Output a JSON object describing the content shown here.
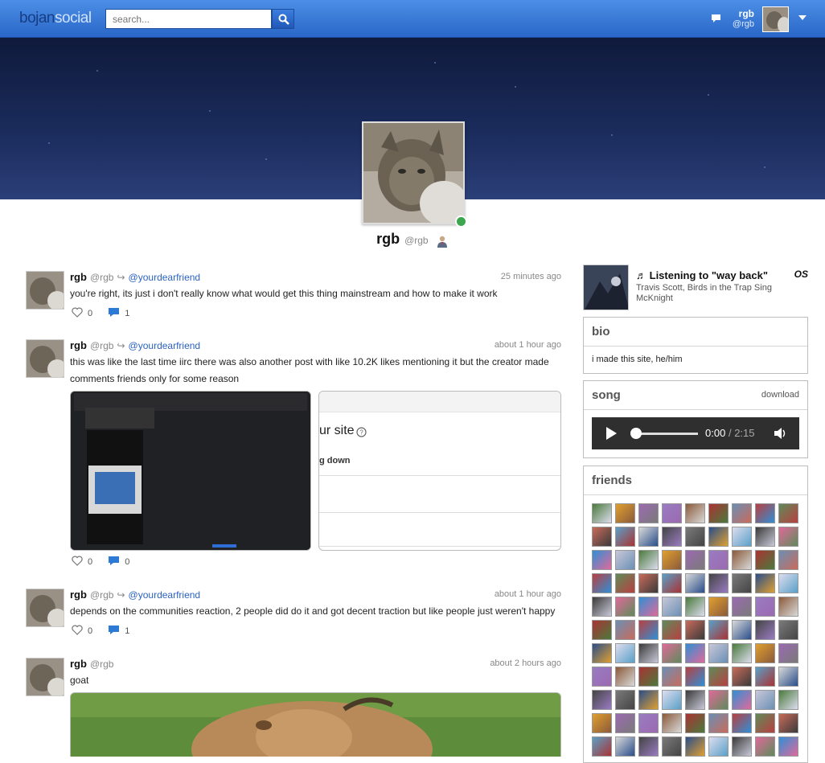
{
  "topbar": {
    "logo_a": "bojan",
    "logo_b": "social",
    "search_placeholder": "search...",
    "user_name": "rgb",
    "user_handle": "@rgb"
  },
  "profile": {
    "name": "rgb",
    "handle": "@rgb"
  },
  "posts": [
    {
      "name": "rgb",
      "handle": "@rgb",
      "arrow": "↪",
      "to": "@yourdearfriend",
      "time": "25 minutes ago",
      "text": "you're right, its just i don't really know what would get this thing mainstream and how to make it work",
      "likes": "0",
      "comments": "1"
    },
    {
      "name": "rgb",
      "handle": "@rgb",
      "arrow": "↪",
      "to": "@yourdearfriend",
      "time": "about 1 hour ago",
      "text": "this was like the last time iirc there was also another post with like 10.2K likes mentioning it but the creator made comments friends only for some reason",
      "likes": "0",
      "comments": "0",
      "embed_text_1": "ur site",
      "embed_text_2": "g down"
    },
    {
      "name": "rgb",
      "handle": "@rgb",
      "arrow": "↪",
      "to": "@yourdearfriend",
      "time": "about 1 hour ago",
      "text": "depends on the communities reaction, 2 people did do it and got decent traction but like people just weren't happy",
      "likes": "0",
      "comments": "1"
    },
    {
      "name": "rgb",
      "handle": "@rgb",
      "time": "about 2 hours ago",
      "text": "goat"
    }
  ],
  "now_playing": {
    "title": "Listening to \"way back\"",
    "subtitle": "Travis Scott, Birds in the Trap Sing McKnight",
    "service": "OS"
  },
  "bio": {
    "heading": "bio",
    "text": "i made this site, he/him"
  },
  "song": {
    "heading": "song",
    "download": "download",
    "current": "0:00",
    "separator": "/",
    "total": "2:15"
  },
  "friends": {
    "heading": "friends"
  },
  "colors": {
    "topbar": "#2a67c8",
    "link": "#2a62c0",
    "online": "#3aa64d"
  }
}
